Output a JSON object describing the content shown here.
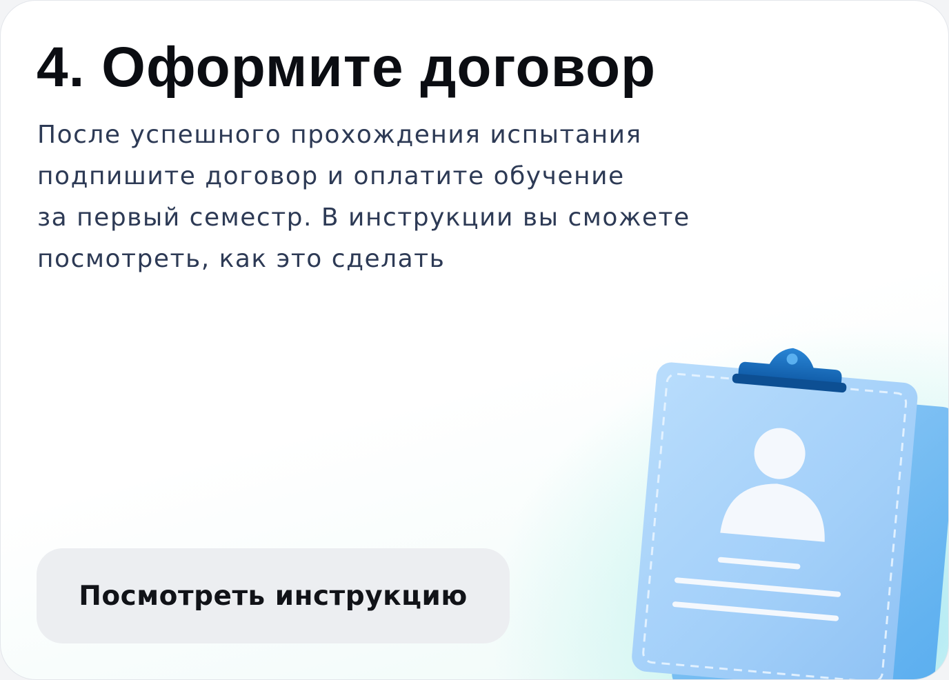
{
  "card": {
    "title": "4. Оформите договор",
    "description_lines": [
      "После успешного прохождения испытания",
      "подпишите договор и оплатите обучение",
      "за первый семестр. В инструкции вы сможете",
      "посмотреть, как это сделать"
    ],
    "button_label": "Посмотреть инструкцию"
  },
  "illustration": {
    "icon": "clipboard-contract-icon",
    "colors": {
      "board": "#a9d4fb",
      "board_back": "#6fb7f3",
      "clip": "#1566b5",
      "figure": "#f4f8fd"
    }
  }
}
